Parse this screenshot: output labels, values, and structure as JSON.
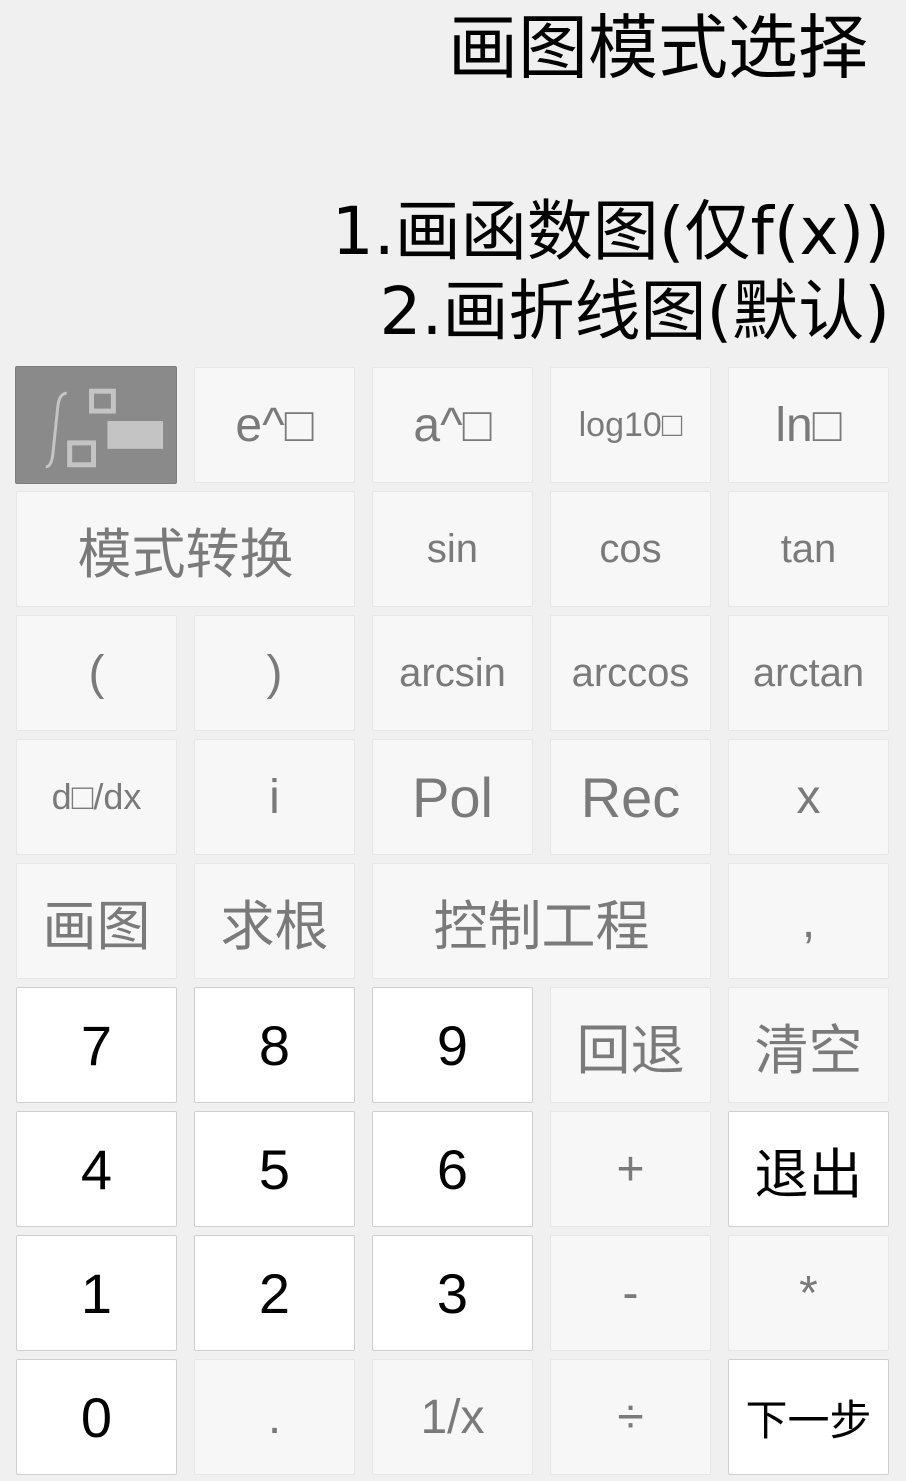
{
  "display": {
    "title": "画图模式选择",
    "line1": "1.画函数图(仅f(x))",
    "line2": "2.画折线图(默认)"
  },
  "keys": {
    "integral": "integral-icon",
    "e_pow": "e^□",
    "a_pow": "a^□",
    "log10": "log10□",
    "ln": "ln□",
    "mode_switch": "模式转换",
    "sin": "sin",
    "cos": "cos",
    "tan": "tan",
    "lparen": "(",
    "rparen": ")",
    "arcsin": "arcsin",
    "arccos": "arccos",
    "arctan": "arctan",
    "deriv": "d□/dx",
    "imag": "i",
    "pol": "Pol",
    "rec": "Rec",
    "x": "x",
    "plot": "画图",
    "root": "求根",
    "control": "控制工程",
    "comma": ",",
    "d7": "7",
    "d8": "8",
    "d9": "9",
    "backspace": "回退",
    "clear": "清空",
    "d4": "4",
    "d5": "5",
    "d6": "6",
    "plus": "+",
    "exit": "退出",
    "d1": "1",
    "d2": "2",
    "d3": "3",
    "minus": "-",
    "multiply": "*",
    "d0": "0",
    "dot": ".",
    "reciprocal": "1/x",
    "divide": "÷",
    "next": "下一步"
  },
  "colors": {
    "background": "#f0f0f0",
    "light_key": "#f7f7f7",
    "white_key": "#ffffff",
    "active_key": "#8a8a8a",
    "muted_text": "#7a7a7a"
  }
}
